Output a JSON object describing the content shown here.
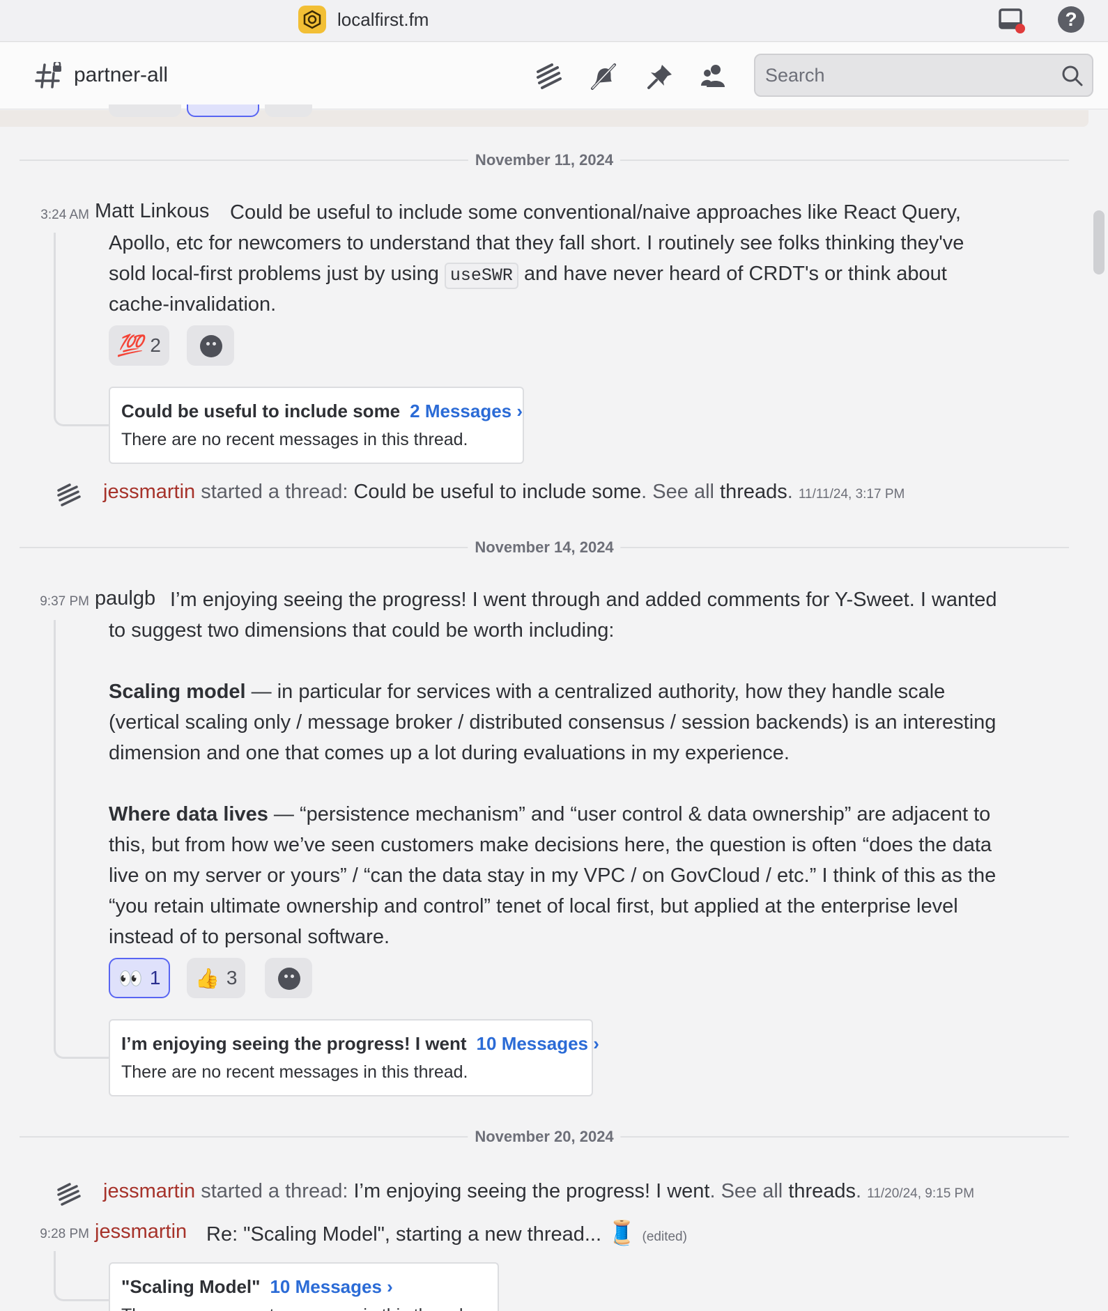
{
  "titlebar": {
    "server_name": "localfirst.fm",
    "icons": [
      "server-logo-icon",
      "inbox-icon",
      "help-icon"
    ],
    "help_glyph": "?"
  },
  "channel": {
    "name": "partner-all",
    "toolbar_icons": [
      "threads-icon",
      "mute-bell-icon",
      "pin-icon",
      "members-icon"
    ],
    "search_placeholder": "Search"
  },
  "dates": {
    "d1": "November 11, 2024",
    "d2": "November 14, 2024",
    "d3": "November 20, 2024"
  },
  "msg1": {
    "time": "3:24 AM",
    "author": "Matt Linkous",
    "line1": "Could be useful to include some conventional/naive approaches like React Query,",
    "line2": "Apollo, etc  for newcomers to understand that they fall short. I routinely see folks thinking they've",
    "line3_pre": "sold local-first problems just by using ",
    "line3_code": "useSWR",
    "line3_post": " and have never heard of CRDT's or think about",
    "line4": "cache-invalidation.",
    "reactions": [
      {
        "emoji": "💯",
        "count": "2"
      }
    ],
    "thread": {
      "name": "Could be useful to include some",
      "count": "2 Messages ›",
      "sub": "There are no recent messages in this thread."
    }
  },
  "sys1": {
    "who": "jessmartin",
    "started": " started a thread: ",
    "thread": "Could be useful to include some",
    "see_all": ". See all ",
    "threads": "threads",
    "dot": ".",
    "stamp": "11/11/24, 3:17 PM"
  },
  "msg2": {
    "time": "9:37 PM",
    "author": "paulgb",
    "line1": "I’m enjoying seeing the progress! I went through and added comments for Y-Sweet. I wanted",
    "line2": "to suggest two dimensions that could be worth including:",
    "p2_bold": "Scaling model",
    "p2_l1": " — in particular for services with a centralized authority, how they handle scale",
    "p2_l2": "(vertical scaling only / message broker / distributed consensus / session backends) is an interesting",
    "p2_l3": "dimension and one that comes up a lot during evaluations in my experience.",
    "p3_bold": "Where data lives",
    "p3_l1": " — “persistence mechanism” and “user control & data ownership” are adjacent to",
    "p3_l2": "this, but from how we’ve seen customers make decisions here, the question is often “does the data",
    "p3_l3": "live on my server or yours” / “can the data stay in my VPC / on GovCloud / etc.” I think of this as the",
    "p3_l4": "“you retain ultimate ownership and control” tenet of local first, but applied at the enterprise level",
    "p3_l5": "instead of to personal software.",
    "reactions": [
      {
        "emoji": "👀",
        "count": "1",
        "active": true
      },
      {
        "emoji": "👍",
        "count": "3"
      }
    ],
    "thread": {
      "name": "I’m enjoying seeing the progress! I went",
      "count": "10 Messages ›",
      "sub": "There are no recent messages in this thread."
    }
  },
  "sys2": {
    "who": "jessmartin",
    "started": " started a thread: ",
    "thread": "I’m enjoying seeing the progress! I went",
    "see_all": ". See all ",
    "threads": "threads",
    "dot": ".",
    "stamp": "11/20/24, 9:15 PM"
  },
  "msg3": {
    "time": "9:28 PM",
    "author": "jessmartin",
    "text": "Re: \"Scaling Model\", starting a new thread...",
    "emoji": "🧵",
    "edited": "(edited)",
    "thread": {
      "name": "\"Scaling Model\"",
      "count": "10 Messages ›",
      "sub": "There are no recent messages in this thread."
    }
  },
  "colors": {
    "accent": "#5865f2",
    "link": "#2b6bd6",
    "author_red": "#a6322a",
    "server_icon": "#f2bf35"
  }
}
